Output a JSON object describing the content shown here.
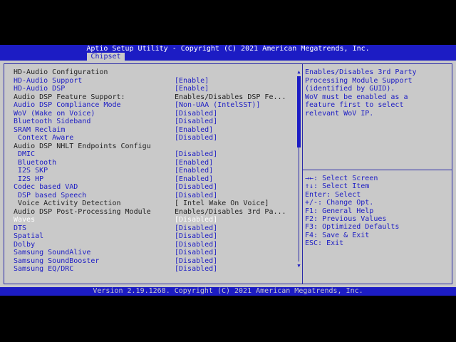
{
  "header": {
    "title": "Aptio Setup Utility - Copyright (C) 2021 American Megatrends, Inc.",
    "tab": "Chipset"
  },
  "section_title": "HD-Audio Configuration",
  "items": [
    {
      "label": "HD-Audio Support",
      "value": "[Enable]"
    },
    {
      "label": "HD-Audio DSP",
      "value": "[Enable]"
    },
    {
      "label": "Audio DSP Feature Support:",
      "value": "Enables/Disables DSP Fe..."
    },
    {
      "label": "Audio DSP Compliance Mode",
      "value": "[Non-UAA (IntelSST)]"
    },
    {
      "label": "WoV (Wake on Voice)",
      "value": "[Disabled]"
    },
    {
      "label": "Bluetooth Sideband",
      "value": "[Disabled]"
    },
    {
      "label": "SRAM Reclaim",
      "value": "[Enabled]"
    },
    {
      "label": "Context Aware",
      "value": "[Disabled]"
    },
    {
      "label": "Audio DSP NHLT Endpoints Configu",
      "value": ""
    },
    {
      "label": "DMIC",
      "value": "[Disabled]"
    },
    {
      "label": "Bluetooth",
      "value": "[Enabled]"
    },
    {
      "label": "I2S SKP",
      "value": "[Enabled]"
    },
    {
      "label": "I2S HP",
      "value": "[Enabled]"
    },
    {
      "label": "Codec based VAD",
      "value": "[Disabled]"
    },
    {
      "label": "DSP based Speech",
      "value": "[Disabled]"
    },
    {
      "label": "Voice Activity Detection",
      "value": "[ Intel Wake On Voice]"
    },
    {
      "label": "Audio DSP Post-Processing Module",
      "value": "Enables/Disables 3rd Pa..."
    },
    {
      "label": "Waves",
      "value": "[Disabled]"
    },
    {
      "label": "DTS",
      "value": "[Disabled]"
    },
    {
      "label": "Spatial",
      "value": "[Disabled]"
    },
    {
      "label": "Dolby",
      "value": "[Disabled]"
    },
    {
      "label": "Samsung SoundAlive",
      "value": "[Disabled]"
    },
    {
      "label": "Samsung SoundBooster",
      "value": "[Disabled]"
    },
    {
      "label": "Samsung EQ/DRC",
      "value": "[Disabled]"
    }
  ],
  "help": {
    "lines": [
      "Enables/Disables 3rd Party",
      "Processing Module Support",
      "(identified by GUID).",
      "WoV must be enabled as a",
      "feature first to select",
      "relevant WoV IP."
    ]
  },
  "keys": [
    "→←: Select Screen",
    "↑↓: Select Item",
    "Enter: Select",
    "+/-: Change Opt.",
    "F1: General Help",
    "F2: Previous Values",
    "F3: Optimized Defaults",
    "F4: Save & Exit",
    "ESC: Exit"
  ],
  "scroll_up_icon": "triangle-up",
  "scroll_down_icon": "triangle-down",
  "footer": "Version 2.19.1268. Copyright (C) 2021 American Megatrends, Inc.",
  "colors": {
    "blue": "#1c1cc4",
    "panel": "#c9c9c9",
    "highlight_text": "#ffffff",
    "header_text": "#222222"
  }
}
